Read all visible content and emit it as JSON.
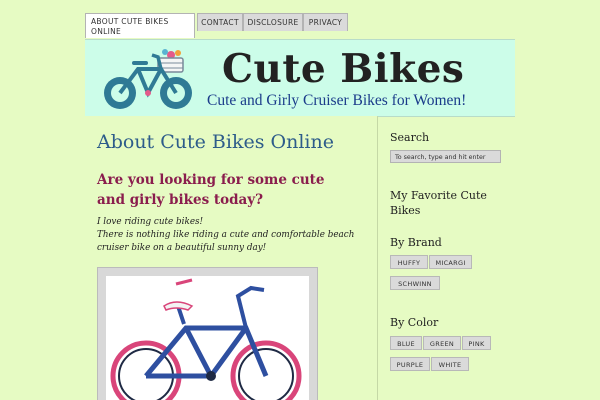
{
  "nav": {
    "tabs": [
      {
        "label": "ABOUT CUTE BIKES ONLINE"
      },
      {
        "label": "CONTACT"
      },
      {
        "label": "DISCLOSURE"
      },
      {
        "label": "PRIVACY"
      }
    ]
  },
  "header": {
    "site_title": "Cute Bikes",
    "tagline": "Cute and Girly Cruiser Bikes for Women!",
    "logo_icon": "bicycle-icon"
  },
  "main": {
    "title": "About Cute Bikes Online",
    "heading": "Are you looking for some cute and girly bikes today?",
    "intro_line1": "I love riding cute bikes!",
    "intro_line2": "There is nothing like riding a cute and comfortable beach cruiser bike on a beautiful sunny day!"
  },
  "sidebar": {
    "search_heading": "Search",
    "search_placeholder": "To search, type and hit enter",
    "favorites_heading": "My Favorite Cute Bikes",
    "brand_heading": "By Brand",
    "brands": [
      "HUFFY",
      "MICARGI",
      "SCHWINN"
    ],
    "color_heading": "By Color",
    "colors": [
      "BLUE",
      "GREEN",
      "PINK",
      "PURPLE",
      "WHITE"
    ]
  },
  "colors": {
    "background": "#e6fbc3",
    "banner": "#ccfde9",
    "title": "#2d5c8a",
    "heading": "#8a1d4d",
    "tagline": "#1a3b8a"
  }
}
